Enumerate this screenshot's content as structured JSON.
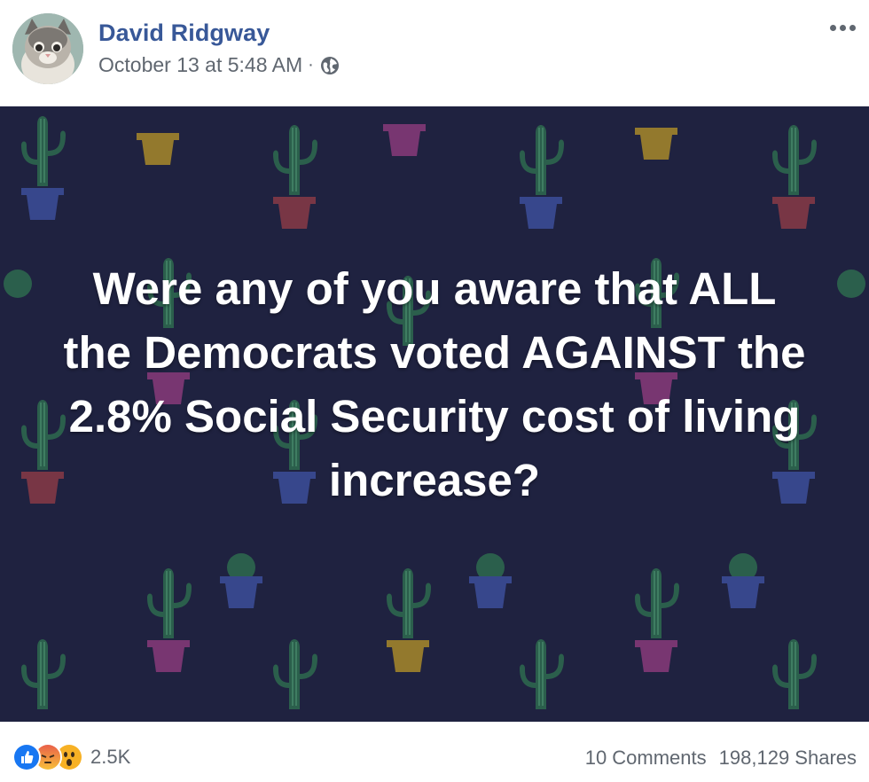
{
  "post": {
    "author": "David Ridgway",
    "timestamp": "October 13 at 5:48 AM",
    "separator": "·",
    "privacy_icon": "globe-icon",
    "menu_icon": "more-options-icon",
    "text": "Were any of you aware that ALL the Democrats voted AGAINST the 2.8% Social Security cost of living increase?",
    "background_color": "#1f2240"
  },
  "engagement": {
    "reactions": [
      "like-reaction-icon",
      "angry-reaction-icon",
      "wow-reaction-icon"
    ],
    "reaction_count": "2.5K",
    "comments": "10 Comments",
    "shares": "198,129 Shares"
  },
  "colors": {
    "author_link": "#385898",
    "meta_text": "#606770",
    "like_blue": "#1877f2",
    "reaction_yellow": "#f7b125"
  }
}
